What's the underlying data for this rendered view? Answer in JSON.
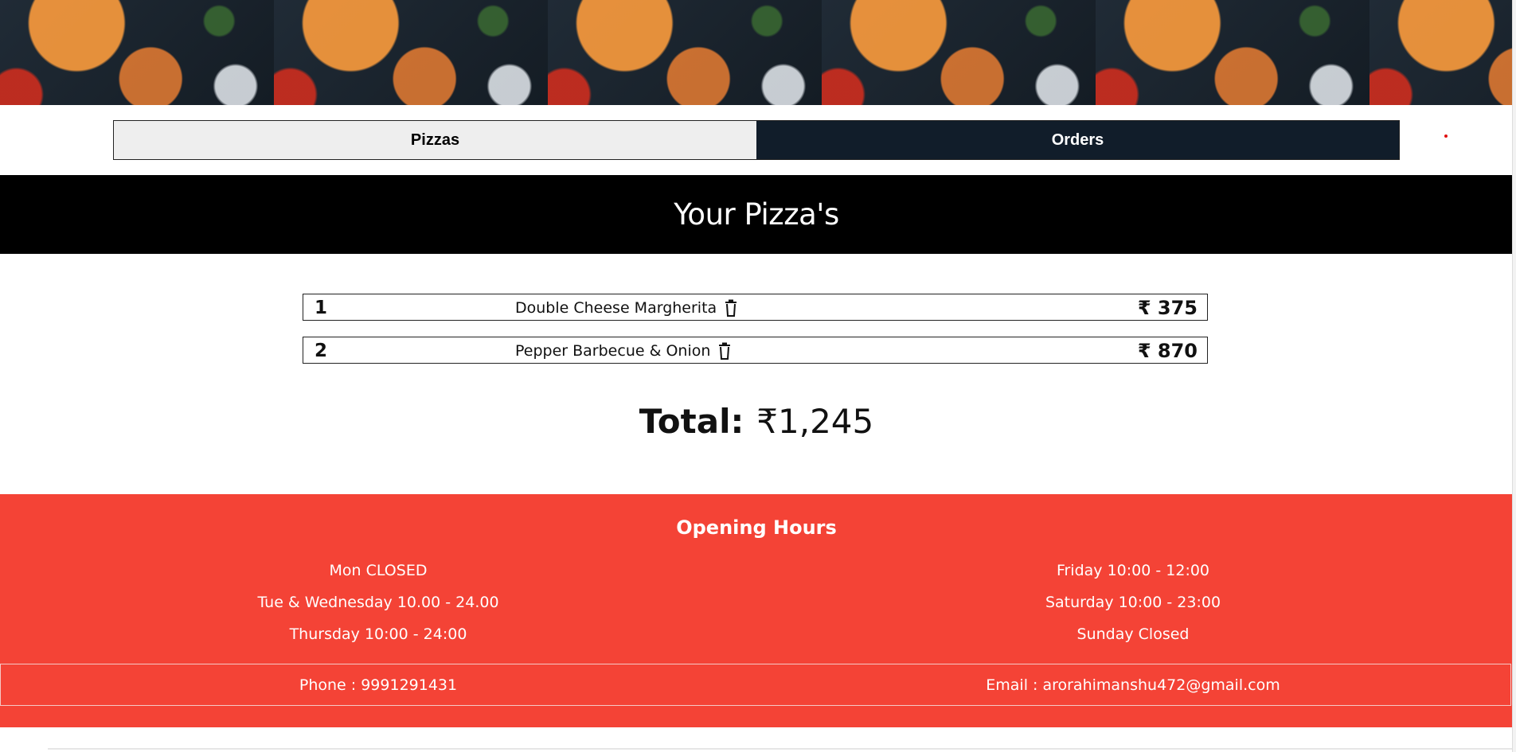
{
  "nav": {
    "tabs": [
      {
        "label": "Pizzas",
        "active": false
      },
      {
        "label": "Orders",
        "active": true
      }
    ]
  },
  "main": {
    "title": "Your Pizza's",
    "orders": [
      {
        "index": "1",
        "name": "Double Cheese Margherita",
        "price": "₹ 375"
      },
      {
        "index": "2",
        "name": "Pepper Barbecue & Onion",
        "price": "₹ 870"
      }
    ],
    "total_label": "Total:",
    "total_value": "₹1,245"
  },
  "footer": {
    "heading": "Opening Hours",
    "hours_left": [
      "Mon CLOSED",
      "Tue & Wednesday 10.00 - 24.00",
      "Thursday 10:00 - 24:00"
    ],
    "hours_right": [
      "Friday 10:00 - 12:00",
      "Saturday 10:00 - 23:00",
      "Sunday Closed"
    ],
    "phone": "Phone : 9991291431",
    "email": "Email : arorahimanshu472@gmail.com"
  },
  "colors": {
    "footer_bg": "#f44336",
    "active_tab": "#111d2a",
    "title_band": "#000000"
  },
  "icons": [
    "trash-icon"
  ]
}
